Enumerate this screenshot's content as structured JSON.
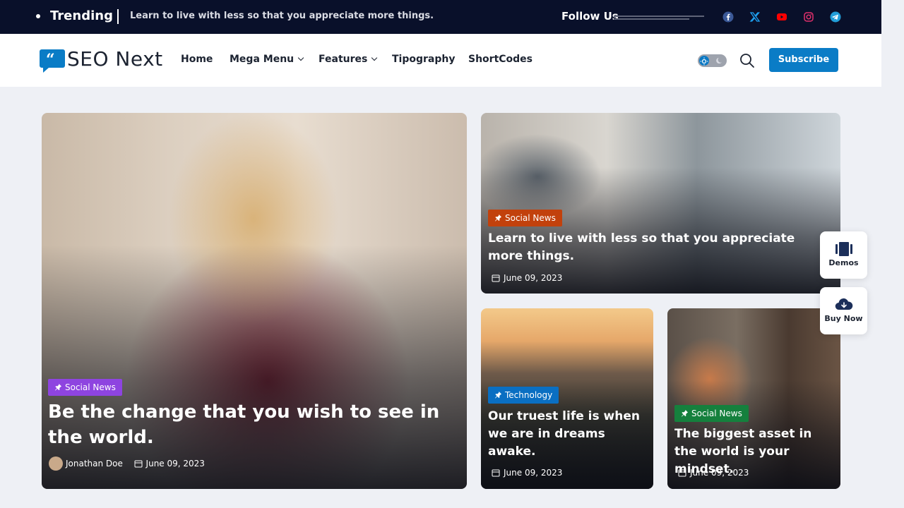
{
  "topbar": {
    "trending_label": "Trending",
    "trending_text": "Learn to live with less so that you appreciate more things.",
    "follow_label": "Follow Us",
    "socials": [
      {
        "icon": "facebook-icon",
        "color": "#3b5998"
      },
      {
        "icon": "x-twitter-icon",
        "color": "#1da1f2"
      },
      {
        "icon": "youtube-icon",
        "color": "#ff0000"
      },
      {
        "icon": "instagram-icon",
        "color": "#e1306c"
      },
      {
        "icon": "telegram-icon",
        "color": "#229ed9"
      }
    ]
  },
  "header": {
    "logo_text": "SEO Next",
    "nav": {
      "home": "Home",
      "mega_menu": "Mega Menu",
      "features": "Features",
      "typography": "Tipography",
      "shortcodes": "ShortCodes"
    },
    "subscribe_label": "Subscribe",
    "accent_color": "#0a7cc6"
  },
  "posts": {
    "main": {
      "category": "Social News",
      "category_color": "#8e44e0",
      "title": "Be the change that you wish to see in the world.",
      "author": "Jonathan Doe",
      "date": "June 09, 2023"
    },
    "top_right": {
      "category": "Social News",
      "category_color": "#c2410c",
      "title": "Learn to live with less so that you appreciate more things.",
      "date": "June 09, 2023"
    },
    "bottom_mid": {
      "category": "Technology",
      "category_color": "#0a6fc2",
      "title": "Our truest life is when we are in dreams awake.",
      "date": "June 09, 2023"
    },
    "bottom_right": {
      "category": "Social News",
      "category_color": "#15803d",
      "title": "The biggest asset in the world is your mindset.",
      "date": "June 09, 2023"
    }
  },
  "floating": {
    "demos_label": "Demos",
    "buy_label": "Buy Now"
  }
}
